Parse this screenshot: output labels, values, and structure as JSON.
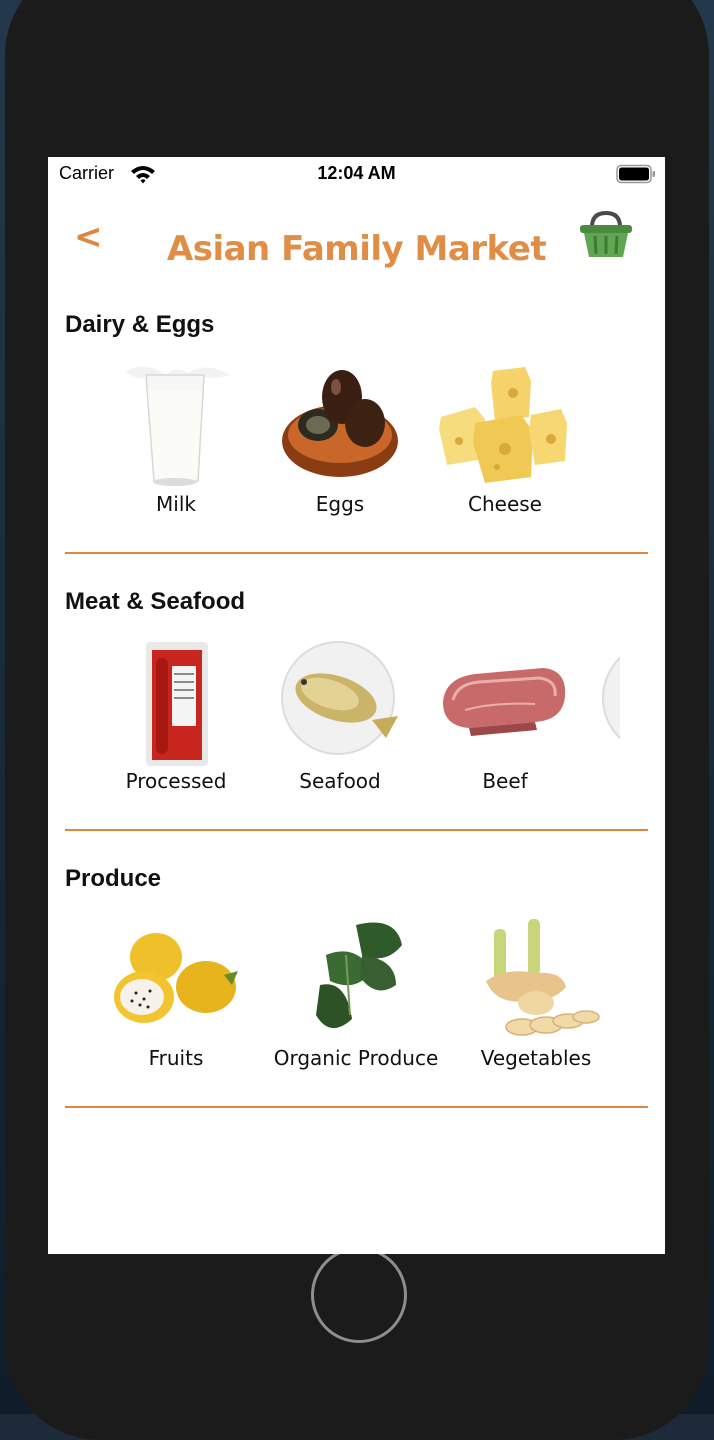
{
  "status_bar": {
    "carrier": "Carrier",
    "time": "12:04 AM"
  },
  "header": {
    "back_label": "<",
    "title": "Asian Family Market",
    "cart_icon": "basket-icon"
  },
  "colors": {
    "accent": "#e0853d",
    "cart_green": "#5a9e4d",
    "background": "#ffffff"
  },
  "sections": [
    {
      "title": "Dairy & Eggs",
      "items": [
        {
          "label": "Milk"
        },
        {
          "label": "Eggs"
        },
        {
          "label": "Cheese"
        }
      ]
    },
    {
      "title": "Meat & Seafood",
      "items": [
        {
          "label": "Processed"
        },
        {
          "label": "Seafood"
        },
        {
          "label": "Beef"
        }
      ]
    },
    {
      "title": "Produce",
      "items": [
        {
          "label": "Fruits"
        },
        {
          "label": "Organic Produce"
        },
        {
          "label": "Vegetables"
        }
      ]
    }
  ]
}
